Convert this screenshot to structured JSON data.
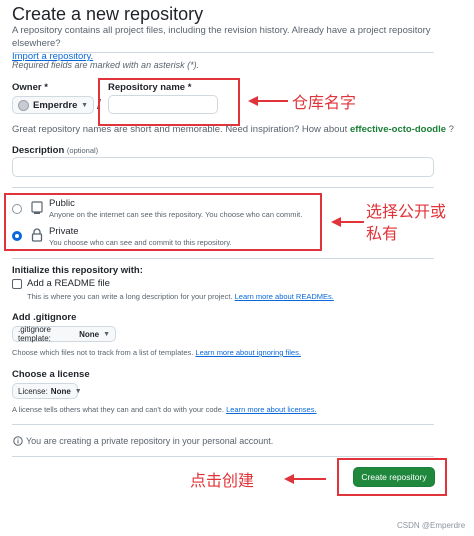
{
  "page": {
    "title": "Create a new repository",
    "intro_text": "A repository contains all project files, including the revision history. Already have a project repository elsewhere?",
    "import_link": "Import a repository.",
    "required_note": "Required fields are marked with an asterisk (*)."
  },
  "owner": {
    "label": "Owner *",
    "value": "Emperdre"
  },
  "repo_name": {
    "label": "Repository name *",
    "value": ""
  },
  "name_hint": {
    "prefix": "Great repository names are short and memorable. Need inspiration? How about",
    "suggestion": "effective-octo-doodle",
    "suffix": "?"
  },
  "description": {
    "label": "Description",
    "optional": "(optional)",
    "value": ""
  },
  "visibility": {
    "public": {
      "title": "Public",
      "desc": "Anyone on the internet can see this repository. You choose who can commit.",
      "selected": false
    },
    "private": {
      "title": "Private",
      "desc": "You choose who can see and commit to this repository.",
      "selected": true
    }
  },
  "initialize": {
    "heading": "Initialize this repository with:",
    "readme_label": "Add a README file",
    "readme_desc": "This is where you can write a long description for your project.",
    "readme_link": "Learn more about READMEs.",
    "readme_checked": false
  },
  "gitignore": {
    "heading": "Add .gitignore",
    "select_prefix": ".gitignore template:",
    "select_value": "None",
    "desc": "Choose which files not to track from a list of templates.",
    "link": "Learn more about ignoring files."
  },
  "license": {
    "heading": "Choose a license",
    "select_prefix": "License:",
    "select_value": "None",
    "desc": "A license tells others what they can and can't do with your code.",
    "link": "Learn more about licenses."
  },
  "notice": "You are creating a private repository in your personal account.",
  "create_button": "Create repository",
  "annotations": {
    "repo_name": "仓库名字",
    "visibility_line1": "选择公开或",
    "visibility_line2": "私有",
    "create": "点击创建"
  },
  "watermark": "CSDN @Emperdre",
  "colors": {
    "accent": "#0969da",
    "create_green": "#1f883d",
    "annotation_red": "#e0343a"
  },
  "icons": [
    "repo-public-icon",
    "lock-icon",
    "info-icon",
    "caret-down-icon"
  ]
}
